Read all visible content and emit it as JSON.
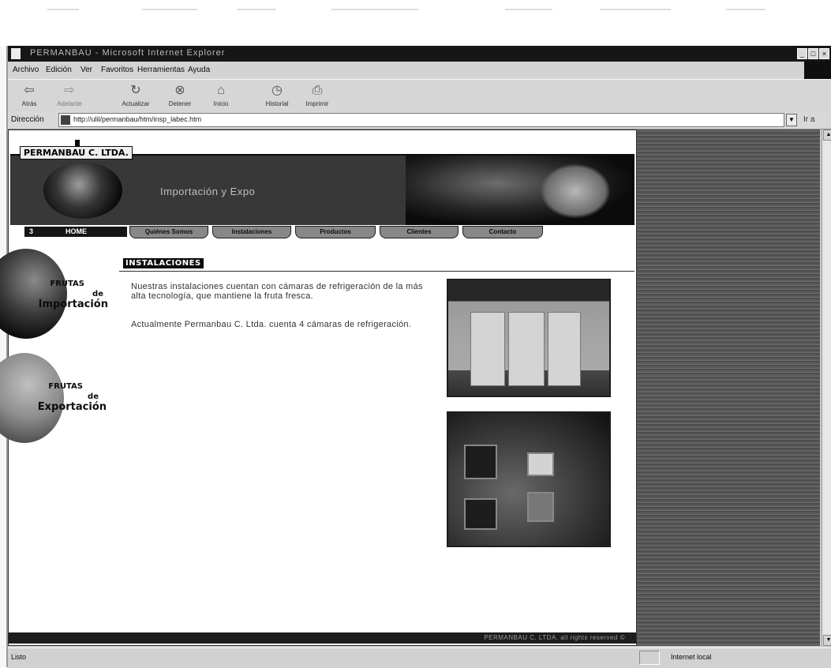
{
  "window": {
    "title": "PERMANBAU - Microsoft Internet Explorer",
    "controls": [
      "_",
      "□",
      "×"
    ]
  },
  "menu": [
    "Archivo",
    "Edición",
    "Ver",
    "Favoritos",
    "Herramientas",
    "Ayuda"
  ],
  "toolbar": [
    {
      "label": "Atrás",
      "icon": "back-arrow-icon"
    },
    {
      "label": "Adelante",
      "icon": "forward-arrow-icon"
    },
    {
      "label": "Actualizar",
      "icon": "refresh-icon"
    },
    {
      "label": "Detener",
      "icon": "stop-icon"
    },
    {
      "label": "Inicio",
      "icon": "home-icon"
    },
    {
      "label": "Historial",
      "icon": "history-icon"
    },
    {
      "label": "Imprimir",
      "icon": "print-icon"
    }
  ],
  "address": {
    "label": "Dirección",
    "url": "http://ulil/permanbau/htm/insp_labec.htm",
    "go_label": "Ir a"
  },
  "site": {
    "logo": "PERMANBAU C. LTDA.",
    "slogan": "Importación y Expo",
    "nav": {
      "home_number": "3",
      "home": "HOME",
      "tabs": [
        "Quiénes Somos",
        "Instalaciones",
        "Productos",
        "Clientes",
        "Contacto"
      ]
    },
    "side_links": [
      {
        "line1": "FRUTAS",
        "line2": "de",
        "line3": "Importación"
      },
      {
        "line1": "FRUTAS",
        "line2": "de",
        "line3": "Exportación"
      }
    ],
    "section_title": "INSTALACIONES",
    "paragraphs": [
      "Nuestras instalaciones cuentan con cámaras de refrigeración de la más alta tecnología, que mantiene la fruta fresca.",
      "Actualmente Permanbau C. Ltda. cuenta 4 cámaras de refrigeración."
    ],
    "footer": "PERMANBAU C. LTDA. all rights reserved ©"
  },
  "status": {
    "text": "Listo",
    "zone": "Internet local"
  }
}
